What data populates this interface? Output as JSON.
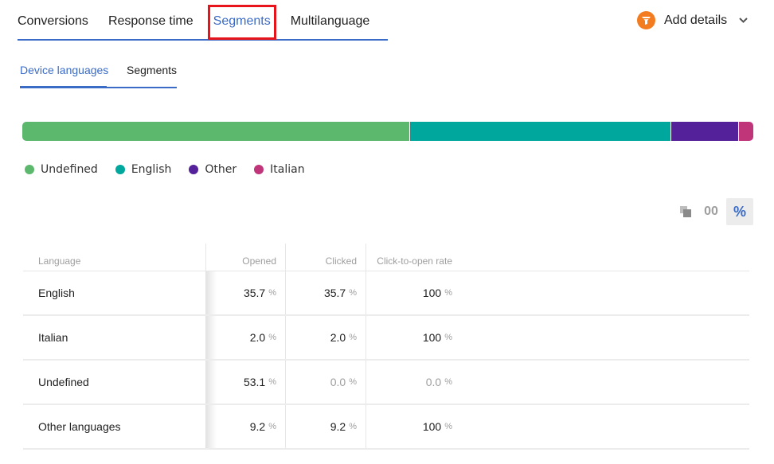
{
  "top_tabs": [
    {
      "label": "Conversions",
      "active": false
    },
    {
      "label": "Response time",
      "active": false
    },
    {
      "label": "Segments",
      "active": true
    },
    {
      "label": "Multilanguage",
      "active": false
    }
  ],
  "add_details": {
    "label": "Add details",
    "icon": "funnel-icon",
    "color": "#f47c20"
  },
  "sub_tabs": [
    {
      "label": "Device languages",
      "active": true
    },
    {
      "label": "Segments",
      "active": false
    }
  ],
  "distribution": [
    {
      "name": "Undefined",
      "percent": 53.1,
      "color": "#5cb86c"
    },
    {
      "name": "English",
      "percent": 35.7,
      "color": "#00a79d"
    },
    {
      "name": "Other",
      "percent": 9.2,
      "color": "#55219a"
    },
    {
      "name": "Italian",
      "percent": 2.0,
      "color": "#c0357a"
    }
  ],
  "view_toggle": {
    "copy_icon": "copy-icon",
    "absolute_label": "00",
    "percent_label": "%",
    "selected": "percent"
  },
  "table": {
    "headers": {
      "language": "Language",
      "opened": "Opened",
      "clicked": "Clicked",
      "ctor": "Click-to-open rate"
    },
    "unit": "%",
    "rows": [
      {
        "language": "English",
        "opened": "35.7",
        "clicked": "35.7",
        "ctor": "100",
        "muted": [
          false,
          false,
          false
        ]
      },
      {
        "language": "Italian",
        "opened": "2.0",
        "clicked": "2.0",
        "ctor": "100",
        "muted": [
          false,
          false,
          false
        ]
      },
      {
        "language": "Undefined",
        "opened": "53.1",
        "clicked": "0.0",
        "ctor": "0.0",
        "muted": [
          false,
          true,
          true
        ]
      },
      {
        "language": "Other languages",
        "opened": "9.2",
        "clicked": "9.2",
        "ctor": "100",
        "muted": [
          false,
          false,
          false
        ]
      }
    ]
  }
}
